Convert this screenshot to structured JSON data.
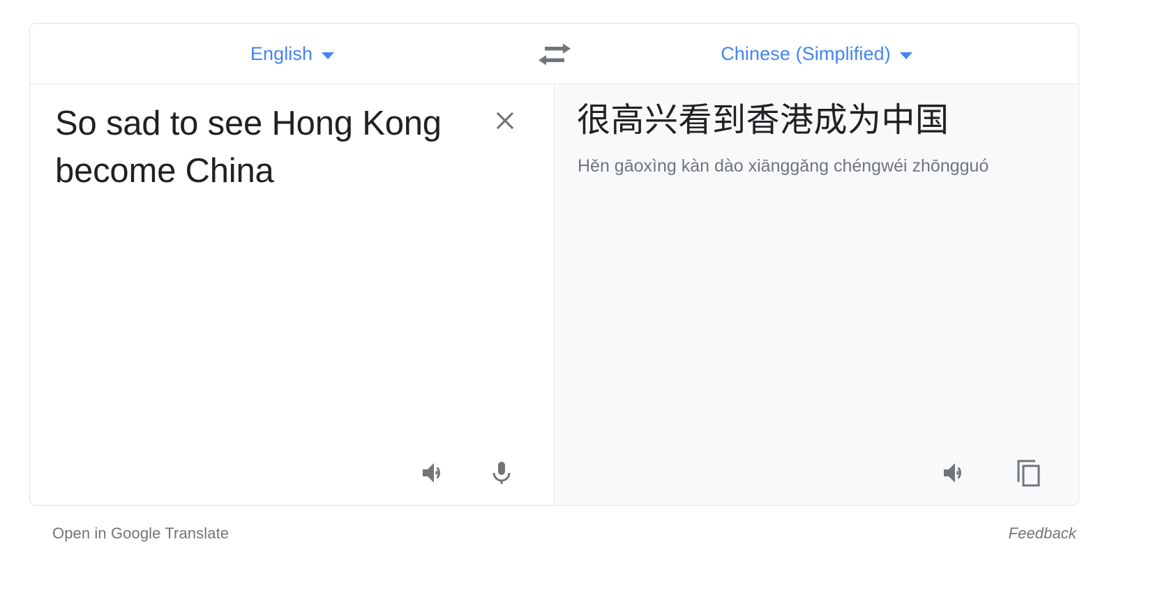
{
  "card": {
    "source_language": {
      "label": "English",
      "caret_icon": "chevron-down-icon"
    },
    "target_language": {
      "label": "Chinese (Simplified)",
      "caret_icon": "chevron-down-icon"
    },
    "swap_icon": "swap-horizontal-icon",
    "source_pane": {
      "text": "So sad to see Hong Kong become China",
      "clear_icon": "close-icon",
      "listen_icon": "speaker-icon",
      "microphone_icon": "microphone-icon"
    },
    "target_pane": {
      "text": "很高兴看到香港成为中国",
      "romanization": "Hěn gāoxìng kàn dào xiānggǎng chéngwéi zhōngguó",
      "listen_icon": "speaker-icon",
      "copy_icon": "copy-icon"
    }
  },
  "footer": {
    "open_link": "Open in Google Translate",
    "feedback_link": "Feedback"
  },
  "colors": {
    "link_blue": "#4285f4",
    "text_primary": "#202124",
    "text_secondary": "#70757a",
    "border": "#dfe1e5",
    "target_pane_bg": "#f8f9fa",
    "icon_gray": "#70757a"
  }
}
